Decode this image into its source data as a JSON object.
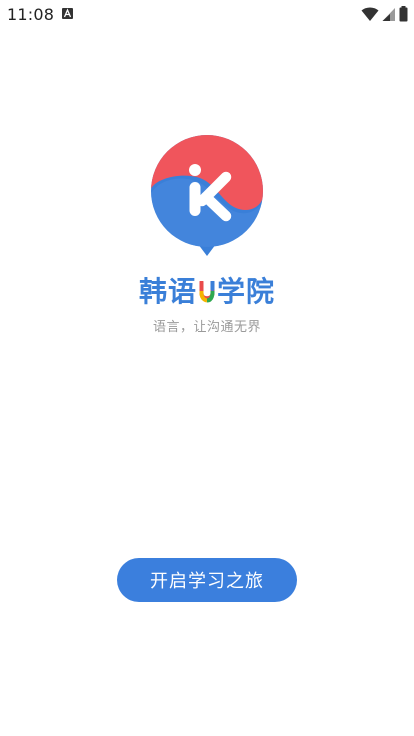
{
  "status_bar": {
    "time": "11:08",
    "icons": [
      "a-badge-icon",
      "wifi-icon",
      "cell-signal-icon",
      "battery-icon"
    ]
  },
  "app": {
    "name_prefix": "韩语",
    "name_u": "U",
    "name_suffix": "学院",
    "tagline": "语言，让沟通无界"
  },
  "actions": {
    "start_label": "开启学习之旅"
  },
  "colors": {
    "brand_blue": "#3b7fdd",
    "logo_red": "#f0555c",
    "logo_blue": "#3a7fd8",
    "tagline_gray": "#9a9a9a"
  }
}
